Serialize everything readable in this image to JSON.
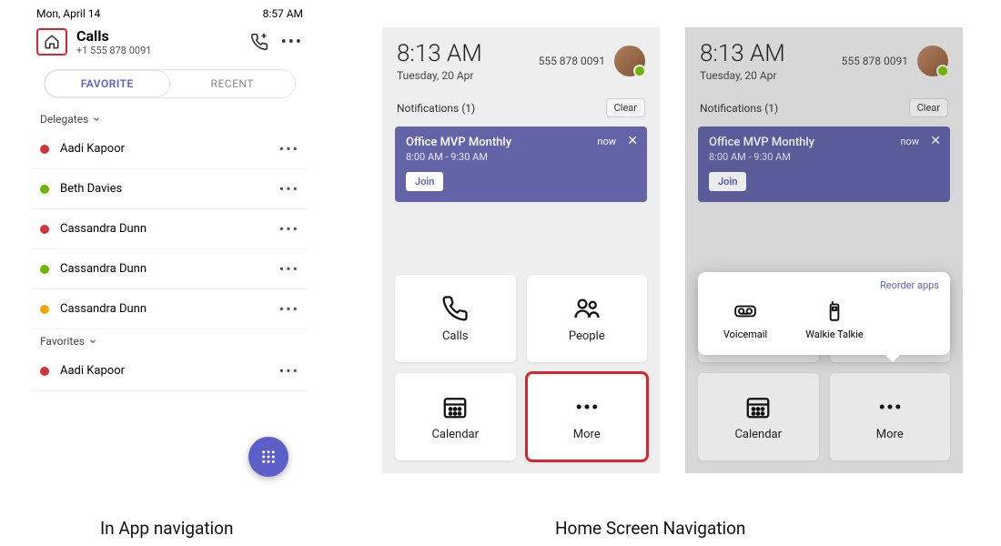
{
  "captions": {
    "left": "In App navigation",
    "right": "Home Screen Navigation"
  },
  "panel1": {
    "status": {
      "date": "Mon, April 14",
      "time": "8:57 AM"
    },
    "title": "Calls",
    "phone": "+1 555 878 0091",
    "tabs": {
      "favorite": "FAVORITE",
      "recent": "RECENT"
    },
    "sections": {
      "delegates_label": "Delegates",
      "favorites_label": "Favorites"
    },
    "delegates": [
      {
        "name": "Aadi Kapoor",
        "presence": "red"
      },
      {
        "name": "Beth Davies",
        "presence": "green"
      },
      {
        "name": "Cassandra Dunn",
        "presence": "red"
      },
      {
        "name": "Cassandra Dunn",
        "presence": "green"
      },
      {
        "name": "Cassandra Dunn",
        "presence": "orange"
      }
    ],
    "favorites": [
      {
        "name": "Aadi Kapoor",
        "presence": "red"
      }
    ]
  },
  "home": {
    "clock": "8:13 AM",
    "date": "Tuesday, 20 Apr",
    "phone": "555 878 0091",
    "notifications_label": "Notifications (1)",
    "clear": "Clear",
    "meeting": {
      "title": "Office MVP Monthly",
      "time": "8:00 AM - 9:30 AM",
      "now": "now",
      "join": "Join"
    },
    "tiles": {
      "calls": "Calls",
      "people": "People",
      "calendar": "Calendar",
      "more": "More"
    }
  },
  "popup": {
    "reorder": "Reorder apps",
    "items": {
      "voicemail": "Voicemail",
      "walkie": "Walkie Talkie"
    }
  }
}
